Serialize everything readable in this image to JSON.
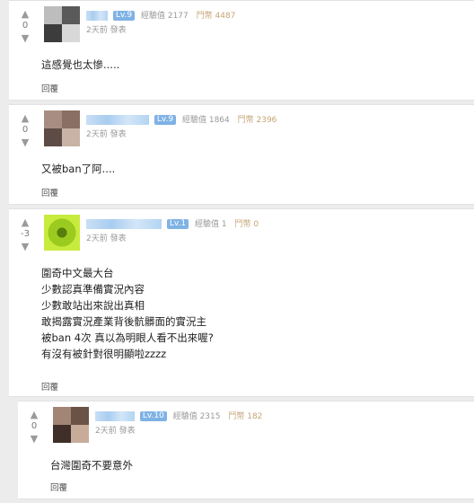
{
  "comments": [
    {
      "score": "0",
      "level": "Lv.9",
      "exp": "經驗值 2177",
      "coins": "鬥幣 4487",
      "time": "2天前 發表",
      "lines": [
        "這感覺也太慘....."
      ],
      "reply": "回覆",
      "avatar_colors": [
        "#5a5a5a",
        "#d8d8d8",
        "#3c3c3c",
        "#bdbdbd"
      ]
    },
    {
      "score": "0",
      "level": "Lv.9",
      "exp": "經驗值 1864",
      "coins": "鬥幣 2396",
      "time": "2天前 發表",
      "lines": [
        "又被ban了阿...."
      ],
      "reply": "回覆",
      "avatar_colors": [
        "#8a6f63",
        "#c9b3a6",
        "#5d4b46",
        "#a88e82"
      ]
    },
    {
      "score": "-3",
      "level": "Lv.1",
      "exp": "經驗值 1",
      "coins": "鬥幣 0",
      "time": "2天前 發表",
      "lines": [
        "圍奇中文最大台",
        "少數認真準備實況內容",
        "少數敢站出來說出真相",
        "敢揭露實況產業背後骯髒面的實況主",
        "被ban 4次 真以為明眼人看不出來喔?",
        "有沒有被針對很明顯啦zzzz"
      ],
      "reply": "回覆",
      "avatar_colors": [
        "#9ccb1f",
        "#6f9e12",
        "#c8ec3e",
        "#587f0c"
      ]
    },
    {
      "score": "0",
      "level": "Lv.10",
      "exp": "經驗值 2315",
      "coins": "鬥幣 182",
      "time": "2天前 發表",
      "lines": [
        "台灣圍奇不要意外"
      ],
      "reply": "回覆",
      "avatar_colors": [
        "#6b5246",
        "#c8ac9a",
        "#3f2f28",
        "#a38576"
      ]
    }
  ],
  "icons": {
    "upvote": "chevron-up-icon",
    "downvote": "chevron-down-icon"
  }
}
